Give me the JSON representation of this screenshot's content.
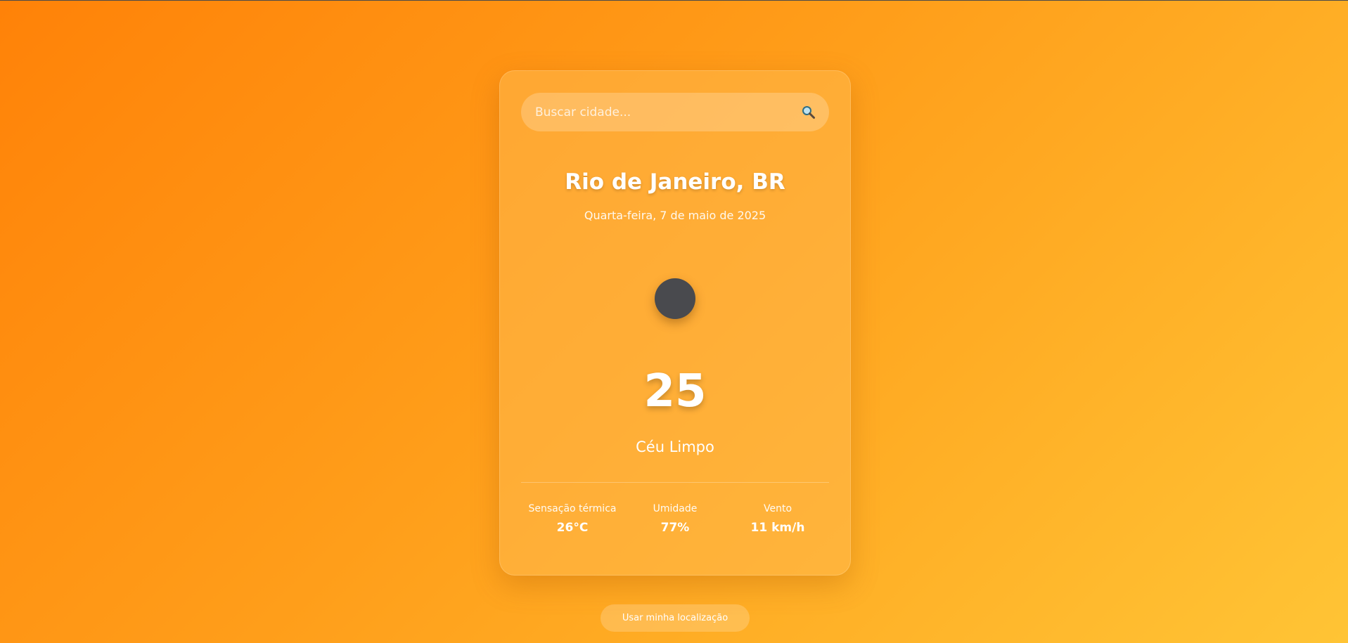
{
  "search": {
    "placeholder": "Buscar cidade..."
  },
  "weather": {
    "city": "Rio de Janeiro, BR",
    "date": "Quarta-feira, 7 de maio de 2025",
    "temperature": "25",
    "description": "Céu Limpo",
    "icon": "clear-sky-icon"
  },
  "details": [
    {
      "label": "Sensação térmica",
      "value": "26°C"
    },
    {
      "label": "Umidade",
      "value": "77%"
    },
    {
      "label": "Vento",
      "value": "11 km/h"
    }
  ],
  "actions": {
    "use_location_label": "Usar minha localização"
  },
  "colors": {
    "gradient_start": "#ff8208",
    "gradient_end": "#ffc435",
    "icon_fill": "#494a4e"
  }
}
